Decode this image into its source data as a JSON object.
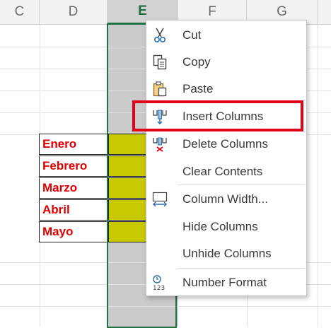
{
  "columns": [
    "C",
    "D",
    "E",
    "F",
    "G"
  ],
  "months": [
    "Enero",
    "Febrero",
    "Marzo",
    "Abril",
    "Mayo"
  ],
  "menu": {
    "items": [
      {
        "label": "Cut",
        "icon": "scissors-icon"
      },
      {
        "label": "Copy",
        "icon": "copy-icon"
      },
      {
        "label": "Paste",
        "icon": "clipboard-icon"
      },
      {
        "label": "Insert Columns",
        "icon": "insert-columns-icon"
      },
      {
        "label": "Delete Columns",
        "icon": "delete-columns-icon"
      },
      {
        "label": "Clear Contents",
        "icon": ""
      },
      {
        "label": "Column Width...",
        "icon": "column-width-icon"
      },
      {
        "label": "Hide Columns",
        "icon": ""
      },
      {
        "label": "Unhide Columns",
        "icon": ""
      },
      {
        "label": "Number Format",
        "icon": "number-format-icon"
      }
    ]
  },
  "colors": {
    "highlight": "#e3001b",
    "month_text": "#e00000",
    "cell_fill": "#c8c800",
    "selection": "#217346"
  }
}
